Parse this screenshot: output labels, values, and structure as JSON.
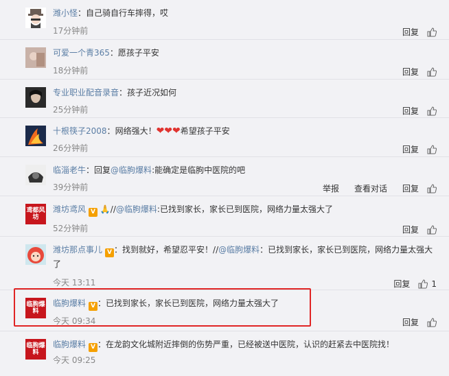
{
  "comments": [
    {
      "author": "潍小怪",
      "text": "自己骑自行车摔得，哎",
      "time": "17分钟前"
    },
    {
      "author": "可爱一个青365",
      "text": "愿孩子平安",
      "time": "18分钟前"
    },
    {
      "author": "专业职业配音录音",
      "text": "孩子近况如何",
      "time": "25分钟前"
    },
    {
      "author": "十根筷子2008",
      "text_before": "网络强大！",
      "hearts": "❤❤❤",
      "text_after": "希望孩子平安",
      "time": "26分钟前"
    },
    {
      "author": "临淄老牛",
      "reply_prefix": "回复",
      "mention": "@临朐爆料",
      "text": ":能确定是临朐中医院的吧",
      "time": "39分钟前"
    },
    {
      "author": "潍坊鸢风",
      "badge": "V",
      "emoji": "🙏",
      "forward": "//",
      "mention": "@临朐爆料",
      "text": ":已找到家长，家长已到医院，网络力量太强大了",
      "time": "52分钟前"
    },
    {
      "author": "潍坊那点事儿",
      "badge": "V",
      "text": "找到就好，希望忍平安！",
      "forward": "//",
      "mention": "@临朐爆料",
      "text2": "：已找到家长，家长已到医院，网络力量太强大了",
      "time": "今天 13:11",
      "likes": "1"
    },
    {
      "author": "临朐爆料",
      "badge": "V",
      "text": "已找到家长，家长已到医院，网络力量太强大了",
      "time": "今天 09:34"
    },
    {
      "author": "临朐爆料",
      "badge": "V",
      "text": "在龙韵文化城附近摔倒的伤势严重，已经被送中医院，认识的赶紧去中医院找！",
      "time": "今天 09:25"
    }
  ],
  "actions": {
    "reply": "回复",
    "report": "举报",
    "view_conversation": "查看对话"
  },
  "avatar_text": {
    "linqu": "临朐爆料",
    "weifang": "鸢都风坊"
  },
  "colors": {
    "link": "#5b7ea5",
    "highlight": "#e02424",
    "badge": "#f5a000",
    "brand_red": "#c7161d"
  }
}
